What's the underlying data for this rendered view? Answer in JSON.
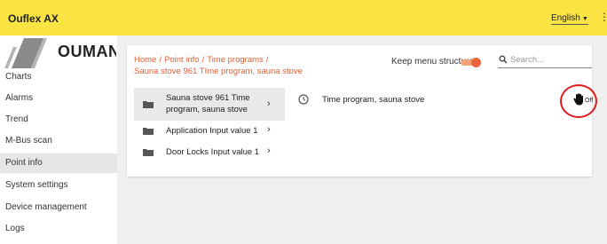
{
  "header": {
    "app_title": "Ouflex AX",
    "language": "English",
    "colors": {
      "bar": "#fae443",
      "accent": "#e0603a",
      "highlight_circle": "#e01a1a"
    }
  },
  "sidebar": {
    "logo_text": "OUMAN",
    "items": [
      {
        "label": "Charts",
        "active": false
      },
      {
        "label": "Alarms",
        "active": false
      },
      {
        "label": "Trend",
        "active": false
      },
      {
        "label": "M-Bus scan",
        "active": false
      },
      {
        "label": "Point info",
        "active": true
      },
      {
        "label": "System settings",
        "active": false
      },
      {
        "label": "Device management",
        "active": false
      },
      {
        "label": "Logs",
        "active": false
      }
    ]
  },
  "main": {
    "breadcrumb": {
      "home": "Home",
      "point_info": "Point info",
      "time_programs": "Time programs",
      "current": "Sauna stove 961 TIme program, sauna stove"
    },
    "keep_menu_label": "Keep menu structure",
    "keep_menu_on": true,
    "search": {
      "placeholder": "Search...",
      "value": ""
    },
    "list": [
      {
        "label": "Sauna stove 961 Time program, sauna stove",
        "selected": true,
        "icon": "folder-icon"
      },
      {
        "label": "Application Input value 1",
        "selected": false,
        "icon": "folder-icon"
      },
      {
        "label": "Door Locks Input value 1",
        "selected": false,
        "icon": "folder-icon"
      }
    ],
    "detail": {
      "icon": "clock-icon",
      "label": "Time program, sauna stove",
      "mode_icon": "hand-icon",
      "mode_label": "Off"
    }
  }
}
